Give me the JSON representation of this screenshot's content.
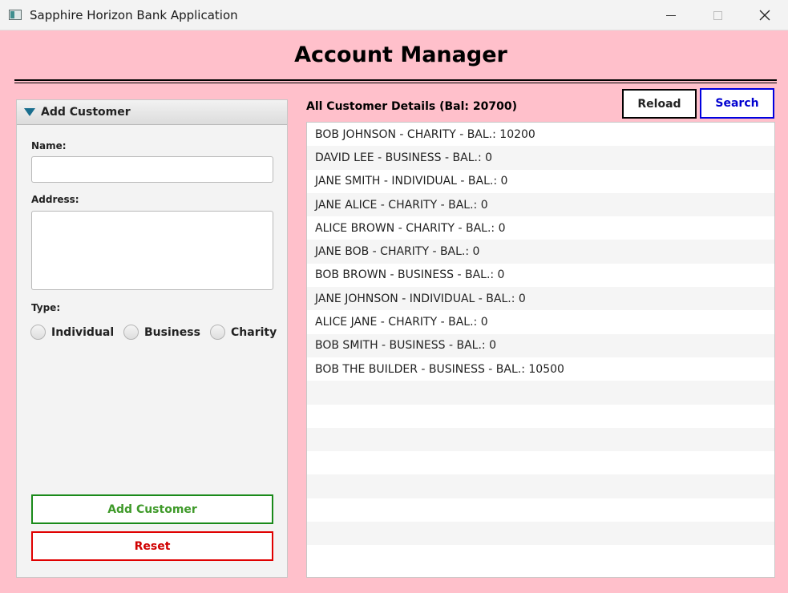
{
  "window": {
    "title": "Sapphire Horizon Bank Application",
    "controls": [
      "minimize",
      "maximize",
      "close"
    ],
    "close_symbol": "✕"
  },
  "header": {
    "title": "Account Manager"
  },
  "add_customer_panel": {
    "title": "Add Customer",
    "name_label": "Name:",
    "name_value": "",
    "address_label": "Address:",
    "address_value": "",
    "type_label": "Type:",
    "type_options": [
      "Individual",
      "Business",
      "Charity"
    ],
    "add_button": "Add Customer",
    "reset_button": "Reset"
  },
  "customer_list": {
    "title": "All Customer Details (Bal: 20700)",
    "reload_button": "Reload",
    "search_button": "Search",
    "items": [
      "BOB JOHNSON - CHARITY - BAL.: 10200",
      "DAVID LEE - BUSINESS - BAL.: 0",
      "JANE SMITH - INDIVIDUAL - BAL.: 0",
      "JANE ALICE - CHARITY - BAL.: 0",
      "ALICE BROWN - CHARITY - BAL.: 0",
      "JANE BOB - CHARITY - BAL.: 0",
      "BOB BROWN - BUSINESS - BAL.: 0",
      "JANE JOHNSON - INDIVIDUAL - BAL.: 0",
      "ALICE JANE - CHARITY - BAL.: 0",
      "BOB SMITH - BUSINESS - BAL.: 0",
      "BOB THE BUILDER - BUSINESS - BAL.: 10500",
      "",
      "",
      "",
      "",
      "",
      "",
      "",
      ""
    ]
  },
  "colors": {
    "background": "#ffc0cb",
    "add_border": "#1a8a1a",
    "reset_border": "#e00000",
    "search_border": "#0000e0"
  }
}
